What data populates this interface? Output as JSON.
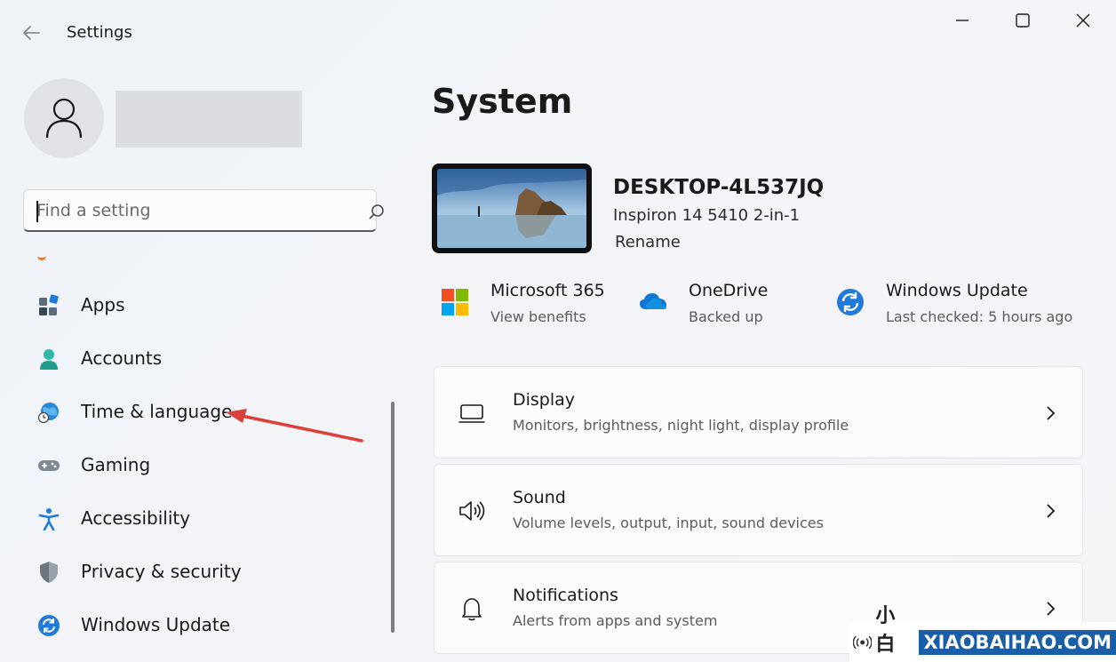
{
  "window": {
    "title": "Settings"
  },
  "user": {
    "name": ""
  },
  "search": {
    "placeholder": "Find a setting"
  },
  "sidebar": {
    "items": [
      {
        "label": "Apps",
        "icon": "apps-icon"
      },
      {
        "label": "Accounts",
        "icon": "accounts-icon"
      },
      {
        "label": "Time & language",
        "icon": "globe-clock-icon"
      },
      {
        "label": "Gaming",
        "icon": "gamepad-icon"
      },
      {
        "label": "Accessibility",
        "icon": "accessibility-icon"
      },
      {
        "label": "Privacy & security",
        "icon": "shield-icon"
      },
      {
        "label": "Windows Update",
        "icon": "windows-update-icon"
      }
    ]
  },
  "main": {
    "title": "System",
    "device": {
      "name": "DESKTOP-4L537JQ",
      "model": "Inspiron 14 5410 2-in-1",
      "rename_label": "Rename"
    },
    "tiles": [
      {
        "title": "Microsoft 365",
        "subtitle": "View benefits",
        "icon": "microsoft-365-icon"
      },
      {
        "title": "OneDrive",
        "subtitle": "Backed up",
        "icon": "onedrive-cloud-icon"
      },
      {
        "title": "Windows Update",
        "subtitle": "Last checked: 5 hours ago",
        "icon": "windows-update-icon"
      }
    ],
    "cards": [
      {
        "title": "Display",
        "subtitle": "Monitors, brightness, night light, display profile",
        "icon": "monitor-icon"
      },
      {
        "title": "Sound",
        "subtitle": "Volume levels, output, input, sound devices",
        "icon": "speaker-icon"
      },
      {
        "title": "Notifications",
        "subtitle": "Alerts from apps and system",
        "icon": "bell-icon"
      }
    ]
  },
  "watermark": {
    "cn": "小白号",
    "en": "XIAOBAIHAO.COM"
  },
  "colors": {
    "accent": "#0067c0",
    "annotation_arrow": "#d9423a",
    "onedrive": "#0f78d4"
  }
}
